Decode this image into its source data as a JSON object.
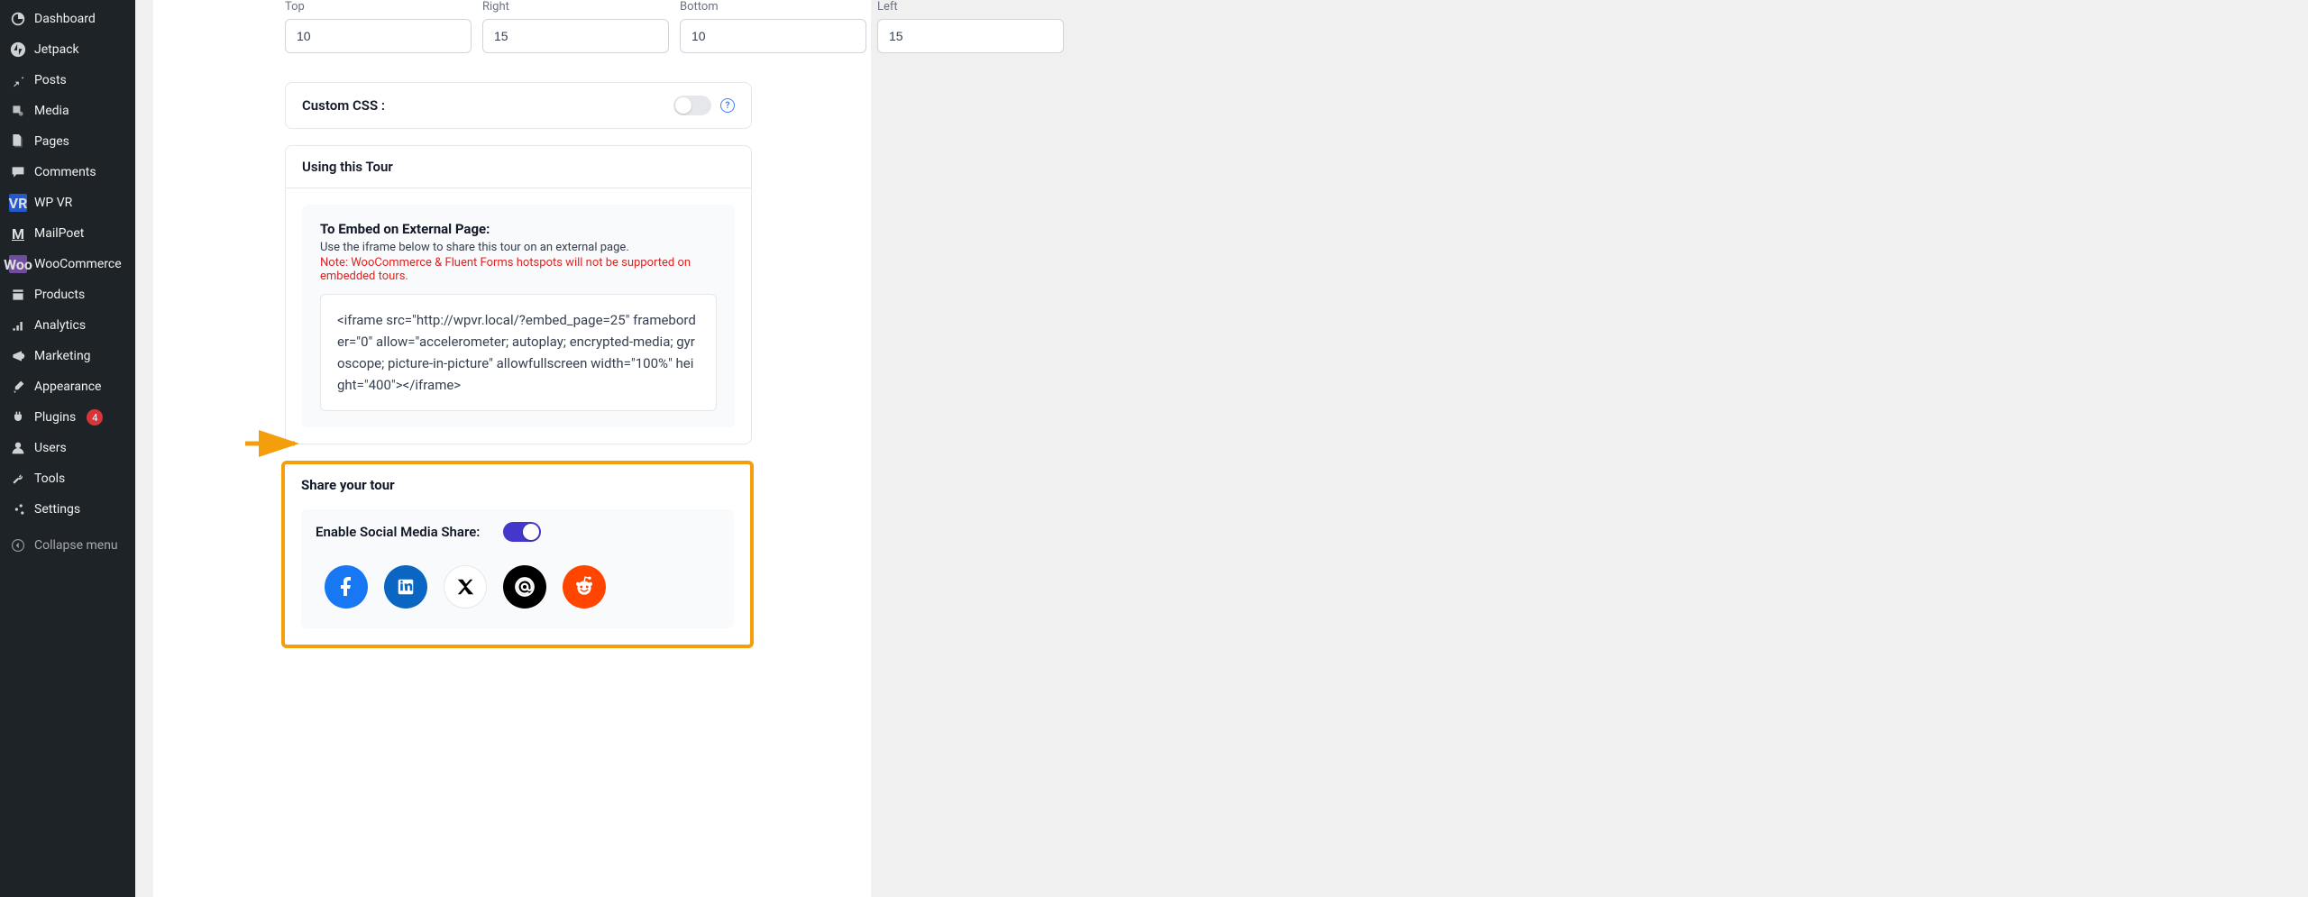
{
  "sidebar": {
    "items": [
      {
        "label": "Dashboard"
      },
      {
        "label": "Jetpack"
      },
      {
        "label": "Posts"
      },
      {
        "label": "Media"
      },
      {
        "label": "Pages"
      },
      {
        "label": "Comments"
      },
      {
        "label": "WP VR"
      },
      {
        "label": "MailPoet"
      },
      {
        "label": "WooCommerce"
      },
      {
        "label": "Products"
      },
      {
        "label": "Analytics"
      },
      {
        "label": "Marketing"
      },
      {
        "label": "Appearance"
      },
      {
        "label": "Plugins",
        "badge": "4"
      },
      {
        "label": "Users"
      },
      {
        "label": "Tools"
      },
      {
        "label": "Settings"
      }
    ],
    "collapse": "Collapse menu"
  },
  "spacing": {
    "top": {
      "label": "Top",
      "value": "10"
    },
    "right": {
      "label": "Right",
      "value": "15"
    },
    "bottom": {
      "label": "Bottom",
      "value": "10"
    },
    "left": {
      "label": "Left",
      "value": "15"
    }
  },
  "custom_css": {
    "title": "Custom CSS :"
  },
  "using_tour": {
    "title": "Using this Tour",
    "embed_title": "To Embed on External Page:",
    "embed_sub": "Use the iframe below to share this tour on an external page.",
    "embed_note": "Note: WooCommerce & Fluent Forms hotspots will not be supported on embedded tours.",
    "iframe_code": "<iframe src=\"http://wpvr.local/?embed_page=25\" frameborder=\"0\" allow=\"accelerometer; autoplay; encrypted-media; gyroscope; picture-in-picture\" allowfullscreen width=\"100%\" height=\"400\"></iframe>"
  },
  "share": {
    "section_title": "Share your tour",
    "enable_label": "Enable Social Media Share:"
  }
}
